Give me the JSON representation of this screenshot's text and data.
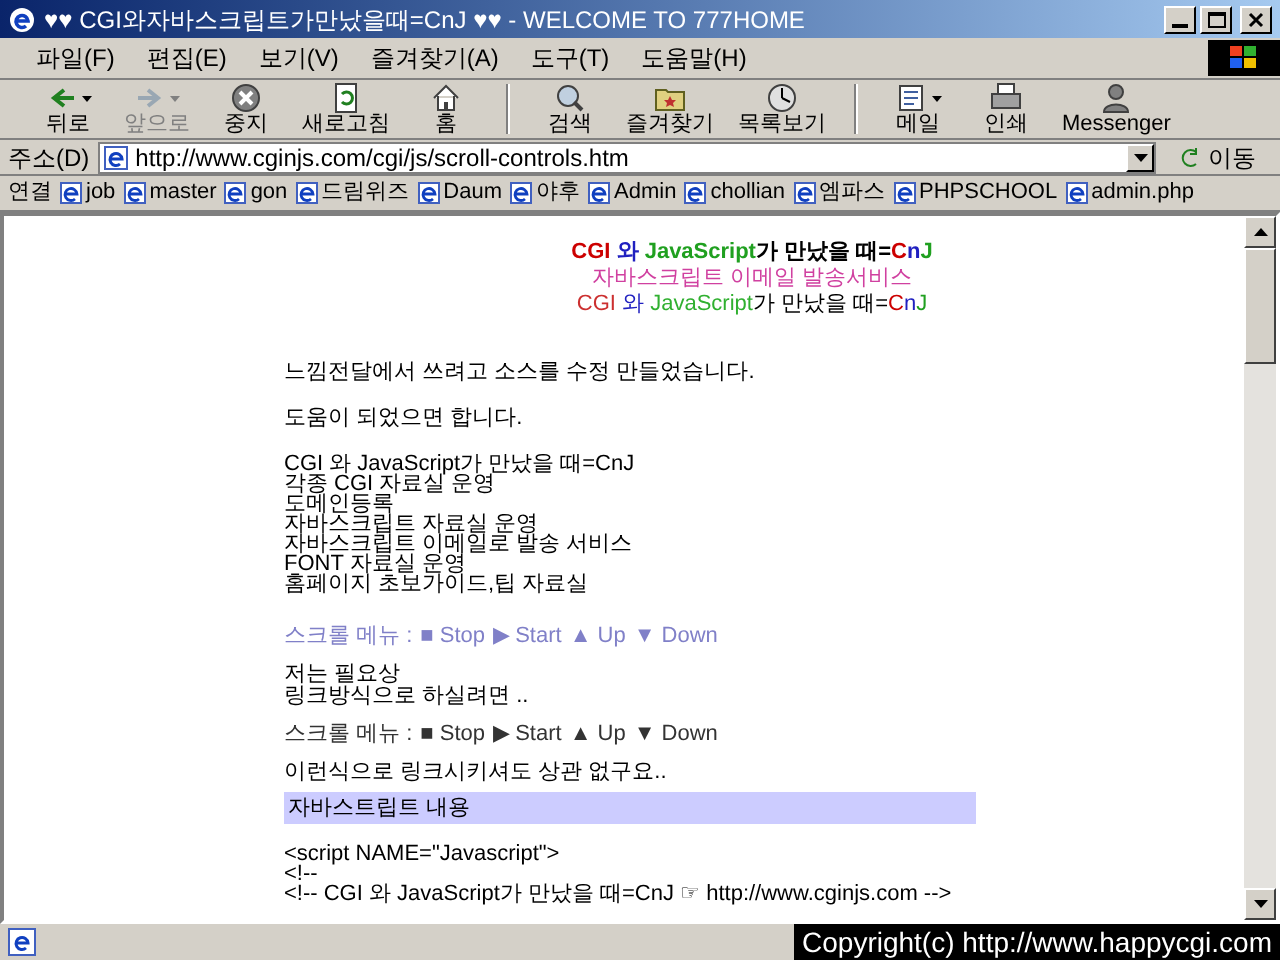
{
  "window": {
    "title": "♥♥ CGI와자바스크립트가만났을때=CnJ ♥♥ - WELCOME TO 777HOME"
  },
  "menu": [
    "파일(F)",
    "편집(E)",
    "보기(V)",
    "즐겨찾기(A)",
    "도구(T)",
    "도움말(H)"
  ],
  "toolbar": [
    {
      "label": "뒤로",
      "kind": "back",
      "dropdown": true,
      "disabled": false
    },
    {
      "label": "앞으로",
      "kind": "forward",
      "dropdown": true,
      "disabled": true
    },
    {
      "label": "중지",
      "kind": "stop",
      "dropdown": false,
      "disabled": false
    },
    {
      "label": "새로고침",
      "kind": "refresh",
      "dropdown": false,
      "disabled": false
    },
    {
      "label": "홈",
      "kind": "home",
      "dropdown": false,
      "disabled": false
    },
    {
      "label": "검색",
      "kind": "search",
      "dropdown": false,
      "disabled": false,
      "group_start": true
    },
    {
      "label": "즐겨찾기",
      "kind": "folder",
      "dropdown": false,
      "disabled": false
    },
    {
      "label": "목록보기",
      "kind": "history",
      "dropdown": false,
      "disabled": false
    },
    {
      "label": "메일",
      "kind": "mail",
      "dropdown": true,
      "disabled": false,
      "group_start": true
    },
    {
      "label": "인쇄",
      "kind": "print",
      "dropdown": false,
      "disabled": false
    },
    {
      "label": "Messenger",
      "kind": "person",
      "dropdown": false,
      "disabled": false
    }
  ],
  "address": {
    "label": "주소(D)",
    "value": "http://www.cginjs.com/cgi/js/scroll-controls.htm",
    "go": "이동"
  },
  "links": {
    "label": "연결",
    "items": [
      "job",
      "master",
      "gon",
      "드림위즈",
      "Daum",
      "야후",
      "Admin",
      "chollian",
      "엠파스",
      "PHPSCHOOL",
      "admin.php"
    ]
  },
  "page": {
    "banner": [
      [
        {
          "text": "CGI",
          "color": "#cc0000"
        },
        {
          "text": " 와 ",
          "color": "#2020c0"
        },
        {
          "text": "JavaScript",
          "color": "#20a020"
        },
        {
          "text": "가 만났을 때=",
          "color": "#000000"
        },
        {
          "text": "C",
          "color": "#cc0000"
        },
        {
          "text": "n",
          "color": "#2020c0"
        },
        {
          "text": "J",
          "color": "#20a020"
        }
      ],
      [
        {
          "text": "자바스크립트 이메일 발송서비스",
          "color": "#d040a0"
        }
      ],
      [
        {
          "text": "CGI",
          "color": "#cc3030"
        },
        {
          "text": " 와 ",
          "color": "#2020c0"
        },
        {
          "text": "JavaScript",
          "color": "#30b030"
        },
        {
          "text": "가 만났을 때=",
          "color": "#000000"
        },
        {
          "text": "C",
          "color": "#cc0000"
        },
        {
          "text": "n",
          "color": "#2020c0"
        },
        {
          "text": "J",
          "color": "#20a020"
        }
      ]
    ],
    "intro": [
      "느낌전달에서 쓰려고 소스를 수정 만들었습니다.",
      "도움이 되었으면 합니다."
    ],
    "scroller": [
      "CGI 와 JavaScript가 만났을 때=CnJ",
      "각종 CGI 자료실 운영",
      "도메인등록",
      "자바스크립트 자료실 운영",
      "자바스크립트 이메일로 발송 서비스",
      "FONT 자료실 운영",
      "홈페이지 초보가이드,팁 자료실"
    ],
    "scroll_menu_1": {
      "label": "스크롤 메뉴 :",
      "links": [
        "■ Stop",
        "▶ Start",
        "▲ Up",
        "▼ Down"
      ],
      "color": "#8080c8"
    },
    "note": [
      "저는 필요상",
      "링크방식으로 하실려면 .."
    ],
    "scroll_menu_2": {
      "label": "스크롤 메뉴 :",
      "links": [
        "■ Stop",
        "▶ Start",
        "▲ Up",
        "▼ Down"
      ],
      "color": "#333333"
    },
    "note2": "이런식으로 링크시키셔도 상관 없구요..",
    "section_title": "자바스트립트 내용",
    "code": [
      "<script NAME=\"Javascript\">",
      "<!--",
      "<!-- CGI 와 JavaScript가 만났을 때=CnJ ☞ http://www.cginjs.com -->"
    ]
  },
  "status_bar": {
    "text": "Copyright(c) http://www.happycgi.com"
  }
}
